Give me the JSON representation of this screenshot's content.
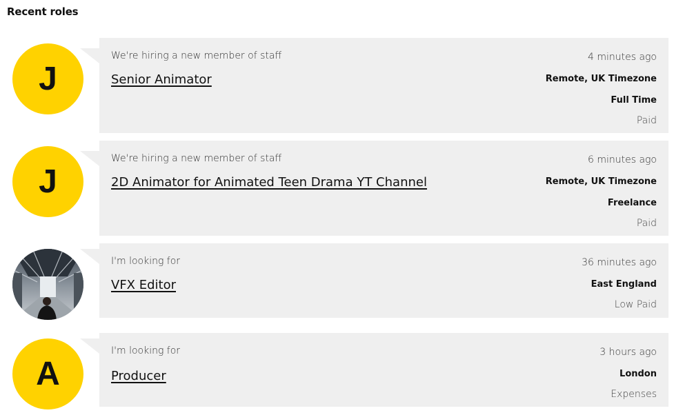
{
  "page": {
    "heading": "Recent roles"
  },
  "colors": {
    "accent": "#FFD200",
    "card_bg": "#EFEFEF"
  },
  "roles": [
    {
      "avatar_letter": "J",
      "intro": "We're hiring a new member of staff",
      "title": "Senior Animator",
      "time": "4 minutes ago",
      "location": "Remote, UK Timezone",
      "type": "Full Time",
      "pay": "Paid"
    },
    {
      "avatar_letter": "J",
      "intro": "We're hiring a new member of staff",
      "title": "2D Animator for Animated Teen Drama YT Channel",
      "time": "6 minutes ago",
      "location": "Remote, UK Timezone",
      "type": "Freelance",
      "pay": "Paid"
    },
    {
      "avatar_letter": "",
      "intro": "I'm looking for",
      "title": "VFX Editor",
      "time": "36 minutes ago",
      "location": "East England",
      "pay": "Low Paid"
    },
    {
      "avatar_letter": "A",
      "intro": "I'm looking for",
      "title": "Producer",
      "time": "3 hours ago",
      "location": "London",
      "pay": "Expenses"
    }
  ]
}
